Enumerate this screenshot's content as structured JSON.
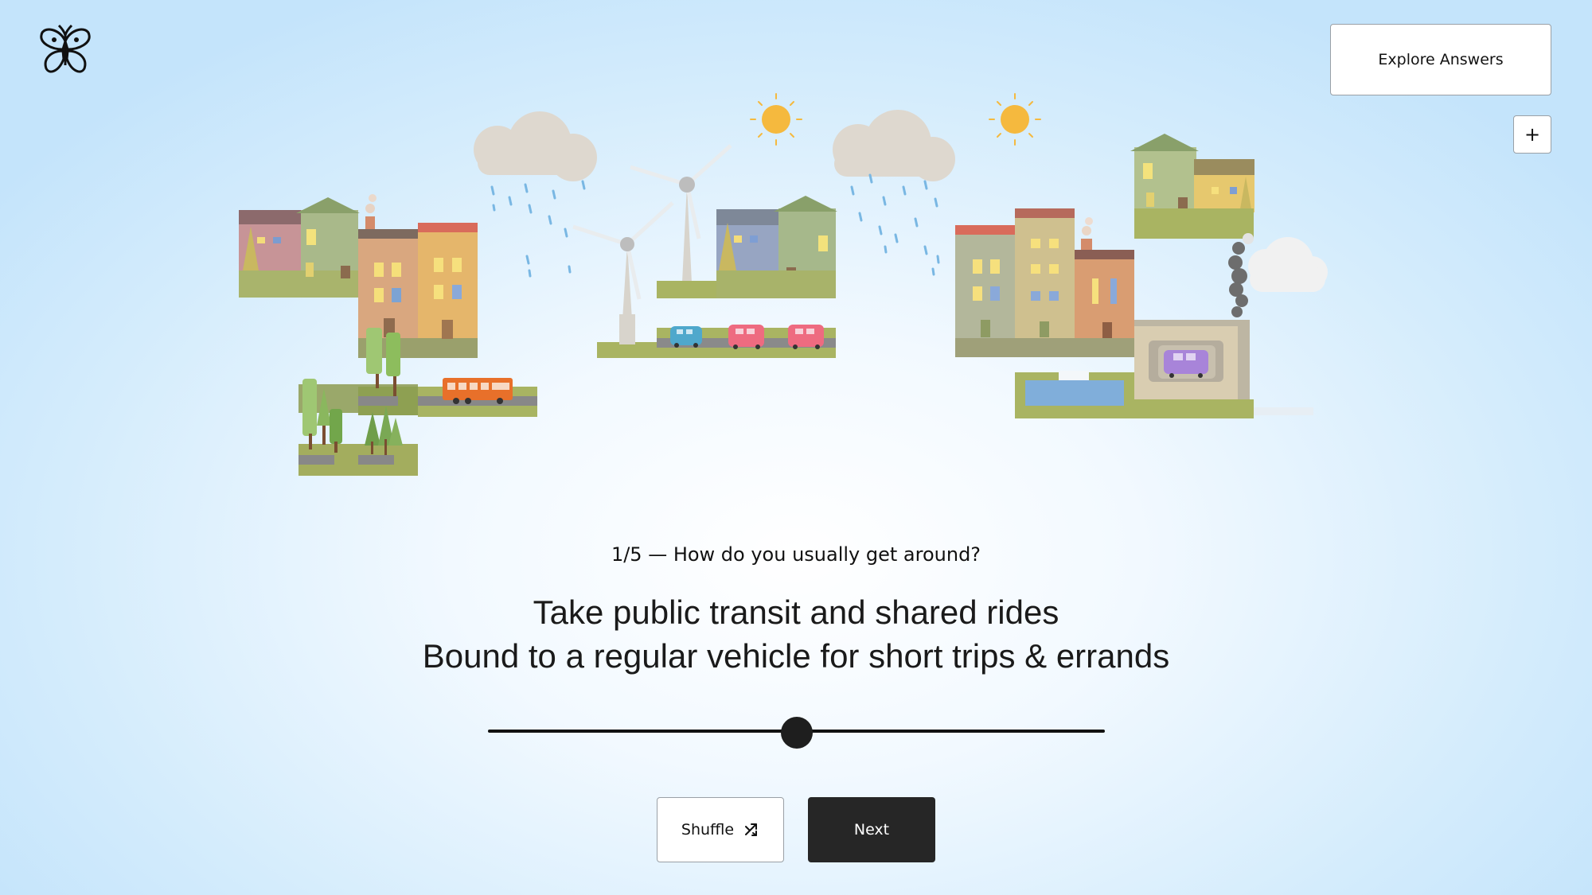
{
  "header": {
    "logo_icon": "butterfly-icon",
    "explore_label": "Explore Answers",
    "expand_label": "+"
  },
  "question": {
    "progress": "1/5",
    "separator": "—",
    "text": "How do you usually get around?",
    "full": "1/5 — How do you usually get around?"
  },
  "answer": {
    "line1": "Take public transit and shared rides",
    "line2": "Bound to a regular vehicle for short trips & errands"
  },
  "slider": {
    "value": 0.5
  },
  "buttons": {
    "shuffle_label": "Shuffle",
    "shuffle_icon": "shuffle-icon",
    "next_label": "Next"
  },
  "colors": {
    "sun": "#f5b93e",
    "cloud": "#ded8cf",
    "grass": "#a7b565",
    "bus": "#e8702a",
    "next_bg": "#262626"
  }
}
